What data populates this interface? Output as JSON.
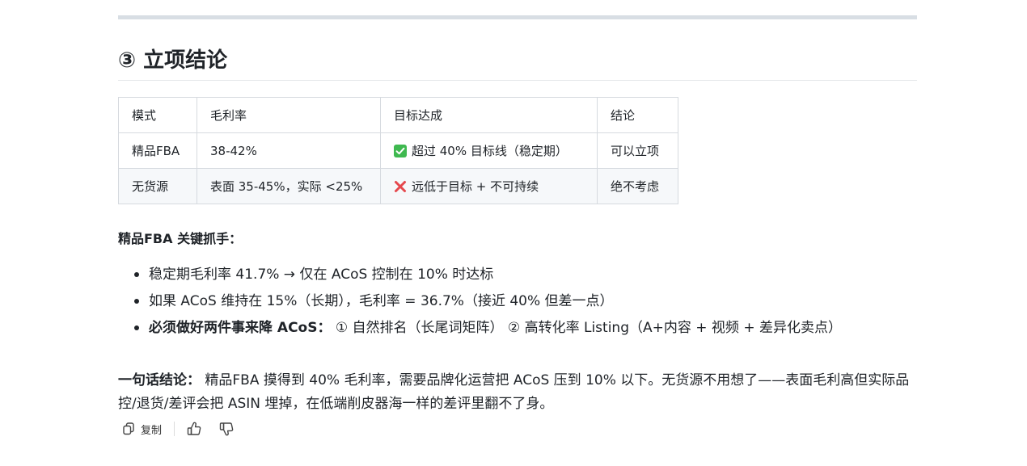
{
  "section": {
    "heading": "③ 立项结论"
  },
  "table": {
    "headers": [
      "模式",
      "毛利率",
      "目标达成",
      "结论"
    ],
    "rows": [
      {
        "mode": "精品FBA",
        "margin": "38-42%",
        "target_icon": "check-mark-button-icon",
        "target": "超过 40% 目标线（稳定期）",
        "conclusion": "可以立项"
      },
      {
        "mode": "无货源",
        "margin": "表面 35-45%，实际 <25%",
        "target_icon": "cross-mark-icon",
        "target": "远低于目标 + 不可持续",
        "conclusion": "绝不考虑"
      }
    ]
  },
  "key_points": {
    "title": "精品FBA 关键抓手：",
    "items": [
      {
        "bold": "",
        "text": "稳定期毛利率 41.7% → 仅在 ACoS 控制在 10% 时达标"
      },
      {
        "bold": "",
        "text": "如果 ACoS 维持在 15%（长期），毛利率 = 36.7%（接近 40% 但差一点）"
      },
      {
        "bold": "必须做好两件事来降 ACoS：",
        "text": " ① 自然排名（长尾词矩阵） ② 高转化率 Listing（A+内容 + 视频 + 差异化卖点）"
      }
    ]
  },
  "summary": {
    "label": "一句话结论：",
    "text": " 精品FBA 摸得到 40% 毛利率，需要品牌化运营把 ACoS 压到 10% 以下。无货源不用想了——表面毛利高但实际品控/退货/差评会把 ASIN 埋掉，在低端削皮器海一样的差评里翻不了身。"
  },
  "actions": {
    "copy_label": "复制",
    "copy_icon": "copy-icon",
    "like_icon": "thumbs-up-icon",
    "dislike_icon": "thumbs-down-icon"
  },
  "colors": {
    "check_green": "#3fb950",
    "cross_red": "#e5484d",
    "table_border": "#d6dadf",
    "row_alt_bg": "#f6f8fa",
    "rule": "#d8dee4"
  }
}
